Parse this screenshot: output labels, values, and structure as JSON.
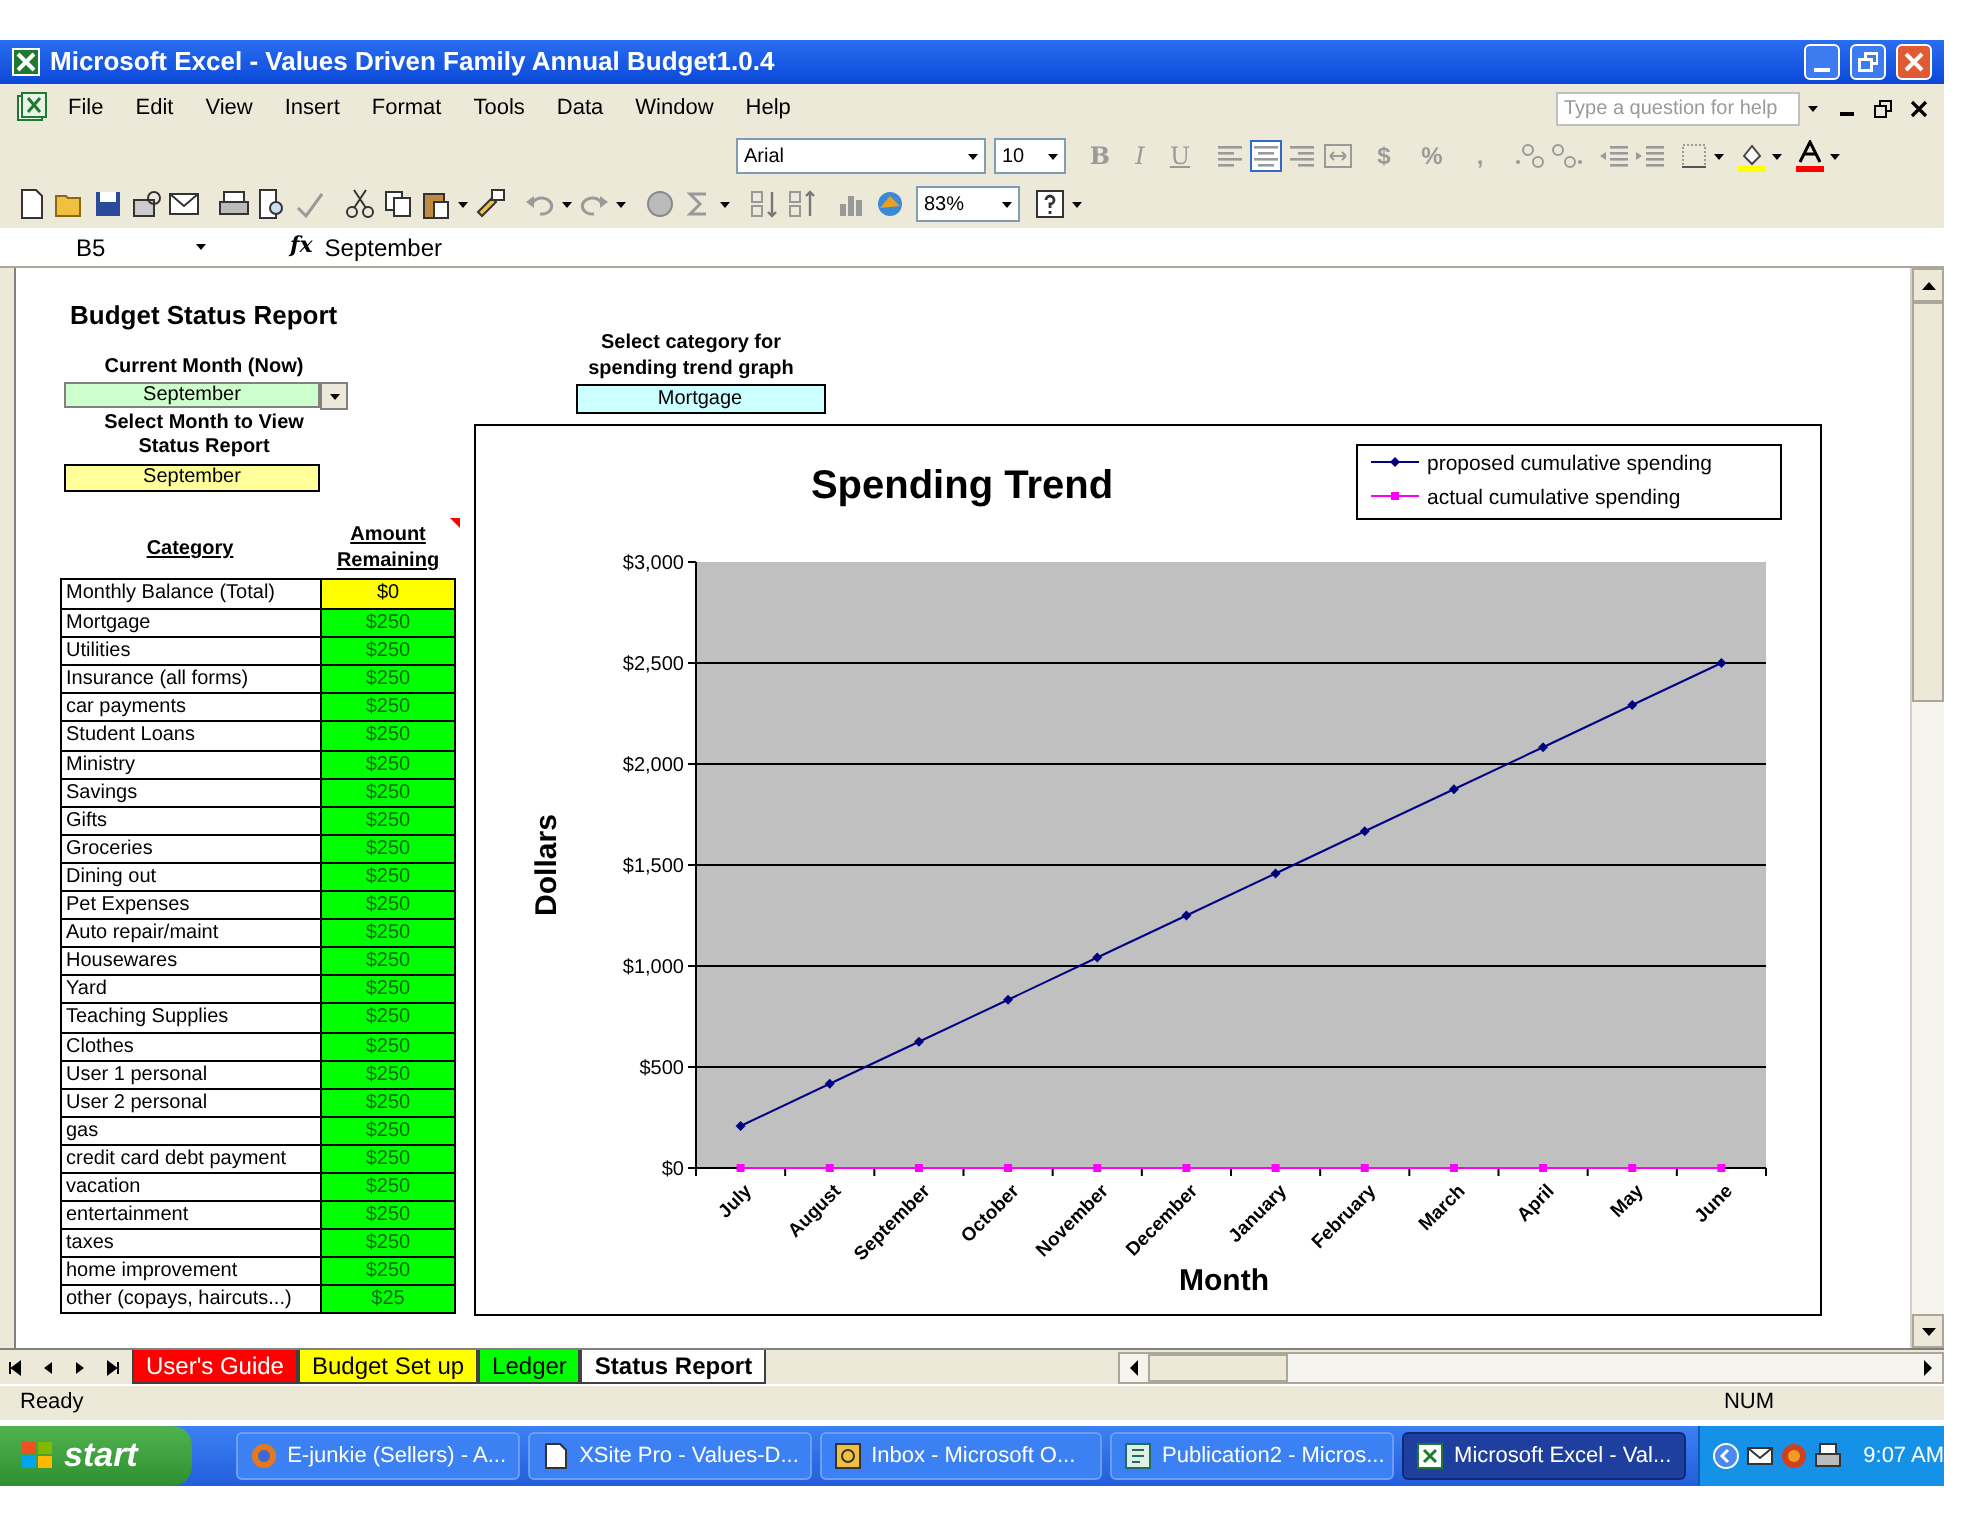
{
  "window": {
    "title": "Microsoft Excel - Values Driven Family Annual Budget1.0.4"
  },
  "menu_bar": {
    "items": [
      "File",
      "Edit",
      "View",
      "Insert",
      "Format",
      "Tools",
      "Data",
      "Window",
      "Help"
    ],
    "help_search": {
      "placeholder": "Type a question for help"
    }
  },
  "formatting_toolbar": {
    "font": "Arial",
    "size": "10",
    "bold": "B",
    "italic": "I",
    "underline": "U",
    "currency": "$",
    "percent": "%",
    "comma": ","
  },
  "standard_toolbar": {
    "zoom": "83%"
  },
  "formula_bar": {
    "cell": "B5",
    "fx": "fx",
    "value": "September"
  },
  "sheet": {
    "title": "Budget Status Report",
    "current_month": {
      "label": "Current Month (Now)",
      "value": "September"
    },
    "view_month": {
      "label": "Select Month to View Status Report",
      "value": "September"
    },
    "category_select": {
      "label": "Select category for spending trend graph",
      "value": "Mortgage"
    },
    "table": {
      "columns": [
        "Category",
        "Amount Remaining"
      ],
      "rows": [
        {
          "kind": "total",
          "category": "Monthly Balance (Total)",
          "amount": "$0"
        },
        {
          "kind": "category",
          "category": "Mortgage",
          "amount": "$250"
        },
        {
          "kind": "category",
          "category": "Utilities",
          "amount": "$250"
        },
        {
          "kind": "category",
          "category": "Insurance (all forms)",
          "amount": "$250"
        },
        {
          "kind": "category",
          "category": "car payments",
          "amount": "$250"
        },
        {
          "kind": "category",
          "category": "Student Loans",
          "amount": "$250"
        },
        {
          "kind": "category",
          "category": "Ministry",
          "amount": "$250"
        },
        {
          "kind": "category",
          "category": "Savings",
          "amount": "$250"
        },
        {
          "kind": "category",
          "category": "Gifts",
          "amount": "$250"
        },
        {
          "kind": "category",
          "category": "Groceries",
          "amount": "$250"
        },
        {
          "kind": "category",
          "category": "Dining out",
          "amount": "$250"
        },
        {
          "kind": "category",
          "category": "Pet Expenses",
          "amount": "$250"
        },
        {
          "kind": "category",
          "category": "Auto repair/maint",
          "amount": "$250"
        },
        {
          "kind": "category",
          "category": "Housewares",
          "amount": "$250"
        },
        {
          "kind": "category",
          "category": "Yard",
          "amount": "$250"
        },
        {
          "kind": "category",
          "category": "Teaching Supplies",
          "amount": "$250"
        },
        {
          "kind": "category",
          "category": "Clothes",
          "amount": "$250"
        },
        {
          "kind": "category",
          "category": "User 1 personal",
          "amount": "$250"
        },
        {
          "kind": "category",
          "category": "User 2 personal",
          "amount": "$250"
        },
        {
          "kind": "category",
          "category": "gas",
          "amount": "$250"
        },
        {
          "kind": "category",
          "category": "credit card debt payment",
          "amount": "$250"
        },
        {
          "kind": "category",
          "category": "vacation",
          "amount": "$250"
        },
        {
          "kind": "category",
          "category": "entertainment",
          "amount": "$250"
        },
        {
          "kind": "category",
          "category": "taxes",
          "amount": "$250"
        },
        {
          "kind": "category",
          "category": "home improvement",
          "amount": "$250"
        },
        {
          "kind": "category",
          "category": "other (copays, haircuts...)",
          "amount": "$25"
        }
      ]
    },
    "chart_data": {
      "type": "line",
      "title": "Spending Trend",
      "xlabel": "Month",
      "ylabel": "Dollars",
      "categories": [
        "July",
        "August",
        "September",
        "October",
        "November",
        "December",
        "January",
        "February",
        "March",
        "April",
        "May",
        "June"
      ],
      "series": [
        {
          "name": "proposed cumulative spending",
          "color": "#000080",
          "marker": "diamond",
          "values": [
            208,
            417,
            625,
            833,
            1042,
            1250,
            1458,
            1667,
            1875,
            2083,
            2292,
            2500
          ]
        },
        {
          "name": "actual cumulative spending",
          "color": "#ff00ff",
          "marker": "square",
          "values": [
            0,
            0,
            0,
            0,
            0,
            0,
            0,
            0,
            0,
            0,
            0,
            0
          ]
        }
      ],
      "grid": true,
      "legend": true,
      "ylim": [
        0,
        3000
      ],
      "yticks": [
        {
          "value": 0,
          "label": "$0"
        },
        {
          "value": 500,
          "label": "$500"
        },
        {
          "value": 1000,
          "label": "$1,000"
        },
        {
          "value": 1500,
          "label": "$1,500"
        },
        {
          "value": 2000,
          "label": "$2,000"
        },
        {
          "value": 2500,
          "label": "$2,500"
        },
        {
          "value": 3000,
          "label": "$3,000"
        }
      ]
    }
  },
  "sheet_tabs": [
    {
      "label": "User's Guide",
      "color": "#ff0000",
      "selected": false
    },
    {
      "label": "Budget Set up",
      "color": "#ffff00",
      "selected": false
    },
    {
      "label": "Ledger",
      "color": "#00ff00",
      "selected": false
    },
    {
      "label": "Status Report",
      "color": "#ffffff",
      "selected": true
    }
  ],
  "status_bar": {
    "status": "Ready",
    "indicator": "NUM"
  },
  "taskbar": {
    "start": "start",
    "items": [
      {
        "label": "E-junkie (Sellers) - A...",
        "selected": false
      },
      {
        "label": "XSite Pro - Values-D...",
        "selected": false
      },
      {
        "label": "Inbox - Microsoft O...",
        "selected": false
      },
      {
        "label": "Publication2 - Micros...",
        "selected": false
      },
      {
        "label": "Microsoft Excel - Val...",
        "selected": true
      }
    ],
    "clock": "9:07 AM"
  }
}
